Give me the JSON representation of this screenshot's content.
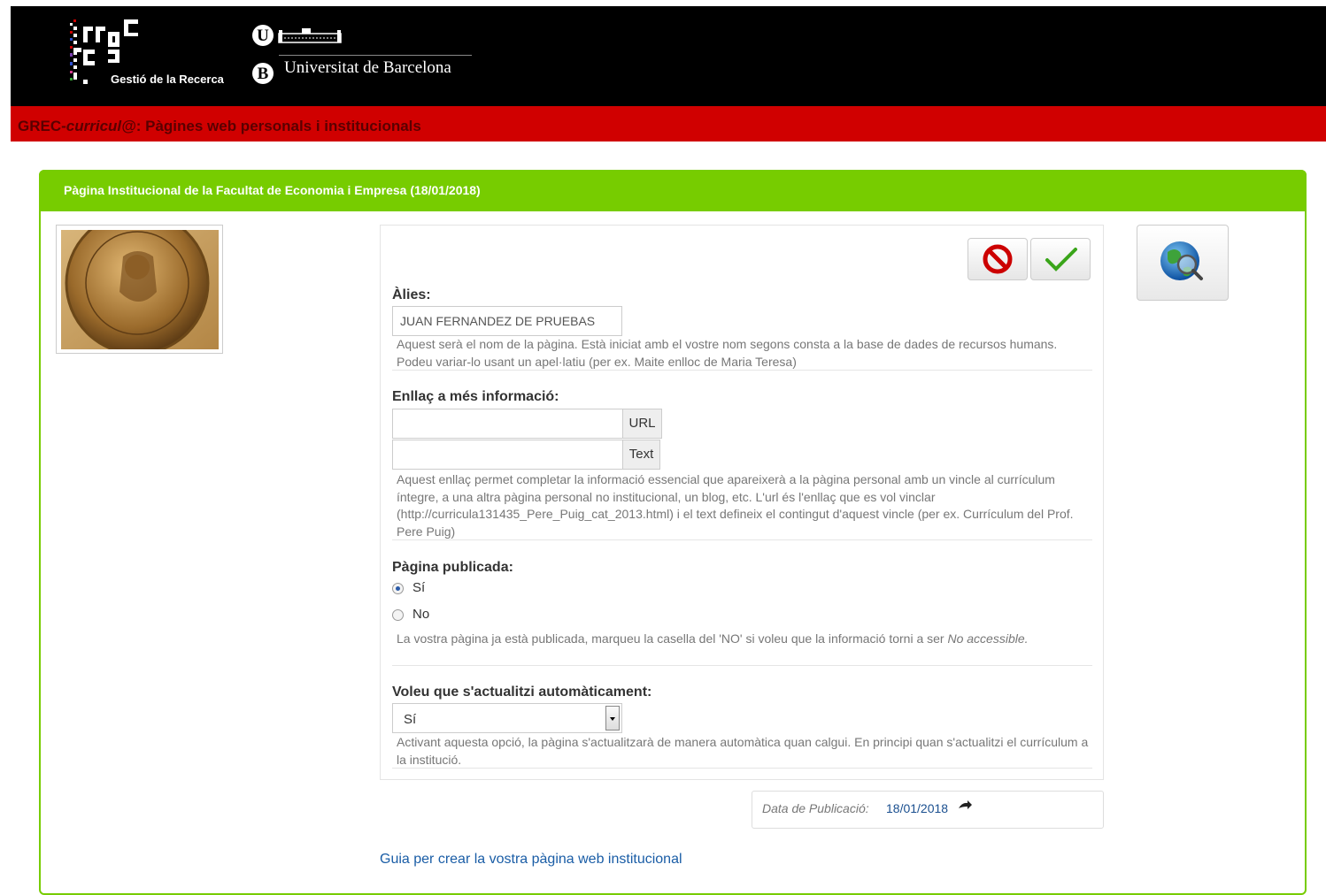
{
  "header": {
    "grec_subtitle": "Gestió de la Recerca",
    "ub_letter_top": "U",
    "ub_letter_bottom": "B",
    "university_name": "Universitat de Barcelona"
  },
  "app_bar": {
    "title_prefix": "GREC-",
    "title_italic": "curricul@",
    "title_suffix": ": Pàgines web personals i institucionals"
  },
  "panel": {
    "title": "Pàgina Institucional de la Facultat de Economia i Empresa (18/01/2018)"
  },
  "icons": {
    "cancel": "cancel-icon",
    "confirm": "check-icon",
    "globe": "globe-search-icon",
    "arrow": "arrow-right-icon"
  },
  "form": {
    "alias_label": "Àlies:",
    "alias_value": "JUAN FERNANDEZ DE PRUEBAS",
    "alias_help": "Aquest serà el nom de la pàgina. Està iniciat amb el vostre nom segons consta a la base de dades de recursos humans. Podeu variar-lo usant un apel·latiu (per ex. Maite enlloc de Maria Teresa)",
    "link_label": "Enllaç a més informació:",
    "url_value": "",
    "url_addon": "URL",
    "text_value": "",
    "text_addon": "Text",
    "link_help": "Aquest enllaç permet completar la informació essencial que apareixerà a la pàgina personal amb un vincle al currículum íntegre, a una altra pàgina personal no institucional, un blog, etc. L'url és l'enllaç que es vol vinclar (http://curricula131435_Pere_Puig_cat_2013.html) i el text defineix el contingut d'aquest vincle (per ex. Currículum del Prof. Pere Puig)",
    "published_label": "Pàgina publicada:",
    "published_yes": "Sí",
    "published_no": "No",
    "published_selected": "Sí",
    "published_help": "La vostra pàgina ja està publicada, marqueu la casella del 'NO' si voleu que la informació torni a ser ",
    "published_help_italic": "No accessible.",
    "autoupdate_label": "Voleu que s'actualitzi automàticament:",
    "autoupdate_value": "Sí",
    "autoupdate_help": "Activant aquesta opció, la pàgina s'actualitzarà de manera automàtica quan calgui. En principi quan s'actualitzi el currículum a la institució."
  },
  "publication": {
    "label": "Data de Publicació:",
    "date": "18/01/2018"
  },
  "guide_link": "Guia per crear la vostra pàgina web institucional",
  "colors": {
    "header_bg": "#000000",
    "app_bar_bg": "#d00000",
    "panel_green": "#77cc00",
    "link_blue": "#1a5da6"
  }
}
